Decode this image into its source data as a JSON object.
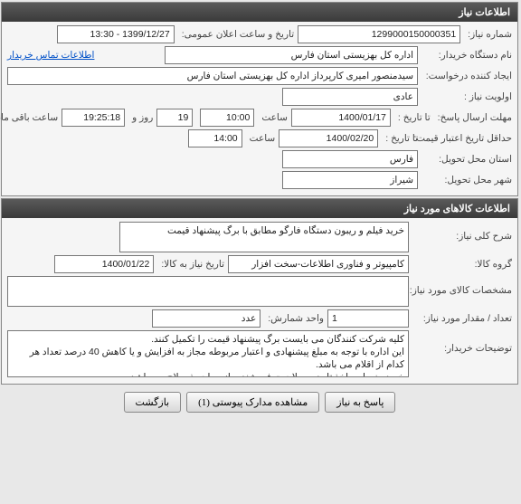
{
  "panel1": {
    "title": "اطلاعات نیاز",
    "need_no_label": "شماره نیاز:",
    "need_no": "1299000150000351",
    "pub_date_label": "تاریخ و ساعت اعلان عمومی:",
    "pub_date": "1399/12/27 - 13:30",
    "buyer_label": "نام دستگاه خریدار:",
    "buyer": "اداره کل بهزیستی استان فارس",
    "contact_link": "اطلاعات تماس خریدار",
    "creator_label": "ایجاد کننده درخواست:",
    "creator": "سیدمنصور امیری کارپرداز اداره کل بهزیستی استان فارس",
    "priority_label": "اولویت نیاز :",
    "priority": "عادی",
    "deadline_label": "مهلت ارسال پاسخ:",
    "to_date_label": "تا تاریخ :",
    "deadline_date": "1400/01/17",
    "hour_label": "ساعت",
    "deadline_time": "10:00",
    "days_val": "19",
    "days_label": "روز و",
    "remain_time": "19:25:18",
    "remain_label": "ساعت باقی مانده",
    "valid_label": "حداقل تاریخ اعتبار قیمت:",
    "valid_date": "1400/02/20",
    "valid_time": "14:00",
    "province_label": "استان محل تحویل:",
    "province": "فارس",
    "city_label": "شهر محل تحویل:",
    "city": "شیراز"
  },
  "panel2": {
    "title": "اطلاعات کالاهای مورد نیاز",
    "desc_label": "شرح کلی نیاز:",
    "desc": "خرید فیلم و ریبون دستگاه فارگو مطابق با برگ پیشنهاد قیمت",
    "group_label": "گروه کالا:",
    "group": "کامپیوتر و فناوری اطلاعات-سخت افزار",
    "need_date_label": "تاریخ نیاز به کالا:",
    "need_date": "1400/01/22",
    "spec_label": "مشخصات کالای مورد نیاز:",
    "spec": "",
    "qty_label": "تعداد / مقدار مورد نیاز:",
    "qty": "1",
    "unit_label": "واحد شمارش:",
    "unit": "عدد",
    "notes_label": "توضیحات خریدار:",
    "notes": "کلیه شرکت کنندگان می بایست برگ پیشنهاد قیمت را تکمیل کنند.\nاین اداره با توجه به مبلغ پیشنهادی و اعتبار مربوطه مجاز به افزایش و یا کاهش 40 درصد تعداد هر کدام از اقلام می باشد.\nخرید منوط به اخذ تاییدیه صلاحیت فروشنده، از مراجع ذیصلاح می باشد"
  },
  "buttons": {
    "reply": "پاسخ به نیاز",
    "docs": "مشاهده مدارک پیوستی (1)",
    "back": "بازگشت"
  }
}
